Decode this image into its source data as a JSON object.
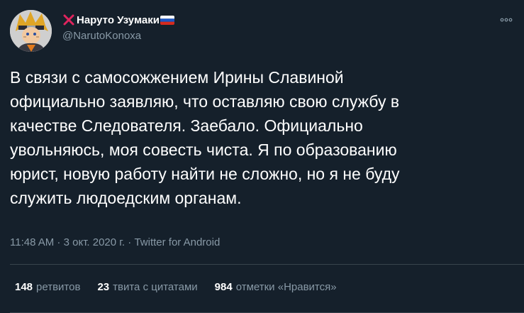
{
  "author": {
    "display_name": "Наруто Узумаки",
    "handle": "@NarutoKonoxa",
    "avatar_icon": "ninja-avatar",
    "name_prefix_icon": "red-cross-icon",
    "name_suffix_icon": "russia-flag-icon"
  },
  "tweet": {
    "text": "В связи с самосожжением Ирины Славиной\nофициально заявляю, что оставляю свою службу в\nкачестве Следователя. Заебало. Официально\nувольняюсь, моя совесть чиста. Я по образованию\nюрист, новую работу найти не сложно, но я не буду\nслужить людоедским органам.",
    "time": "11:48 AM",
    "separator": " · ",
    "date": "3 окт. 2020 г.",
    "source": "Twitter for Android"
  },
  "stats": {
    "retweets_count": "148",
    "retweets_label": "ретвитов",
    "quotes_count": "23",
    "quotes_label": "твита с цитатами",
    "likes_count": "984",
    "likes_label": "отметки «Нравится»"
  },
  "colors": {
    "background": "#15202b",
    "text": "#ffffff",
    "secondary_text": "#8899a6",
    "divider": "#38444d",
    "cross": "#e0245e"
  }
}
